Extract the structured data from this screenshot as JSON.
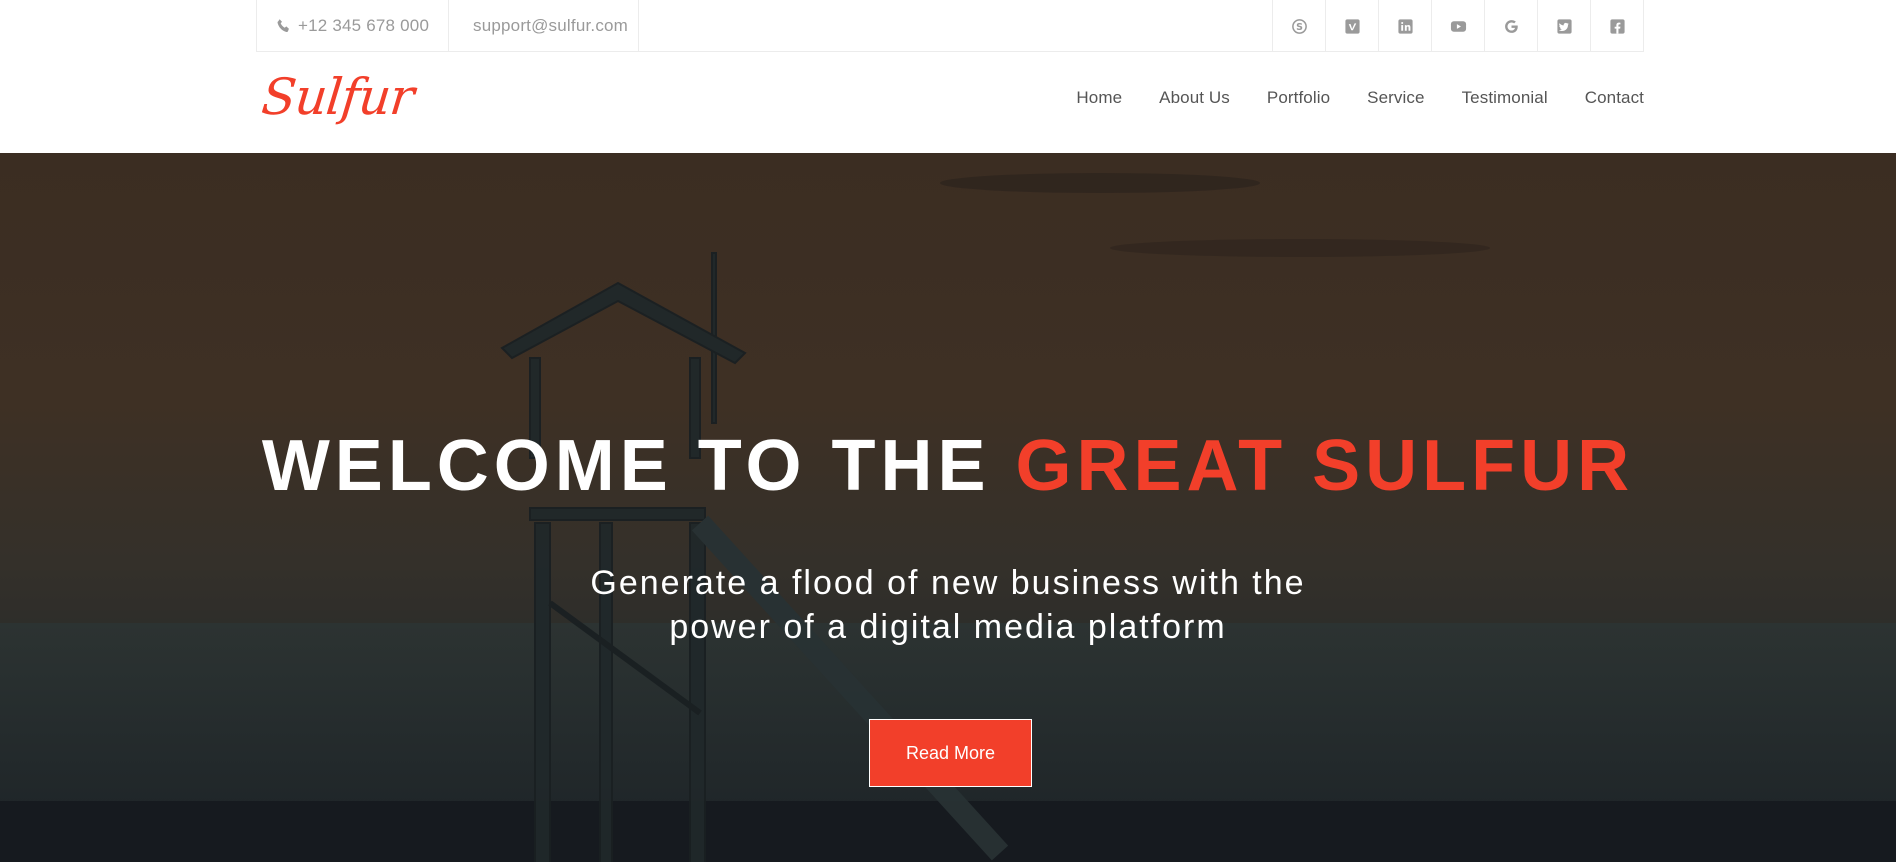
{
  "topbar": {
    "phone": "+12 345 678 000",
    "email": "support@sulfur.com",
    "socials": [
      {
        "icon": "skype-icon"
      },
      {
        "icon": "vimeo-icon"
      },
      {
        "icon": "linkedin-icon"
      },
      {
        "icon": "youtube-icon"
      },
      {
        "icon": "google-icon"
      },
      {
        "icon": "twitter-icon"
      },
      {
        "icon": "facebook-icon"
      }
    ]
  },
  "header": {
    "logo": "Sulfur",
    "nav": [
      "Home",
      "About Us",
      "Portfolio",
      "Service",
      "Testimonial",
      "Contact"
    ]
  },
  "hero": {
    "title_plain": "WELCOME TO THE ",
    "title_accent": "GREAT SULFUR",
    "subtitle_line1": "Generate a flood of new business with the",
    "subtitle_line2": "power of a digital media platform",
    "button": "Read More"
  },
  "colors": {
    "accent": "#f23f2a",
    "muted_text": "#9a9a9a",
    "nav_text": "#555555"
  }
}
